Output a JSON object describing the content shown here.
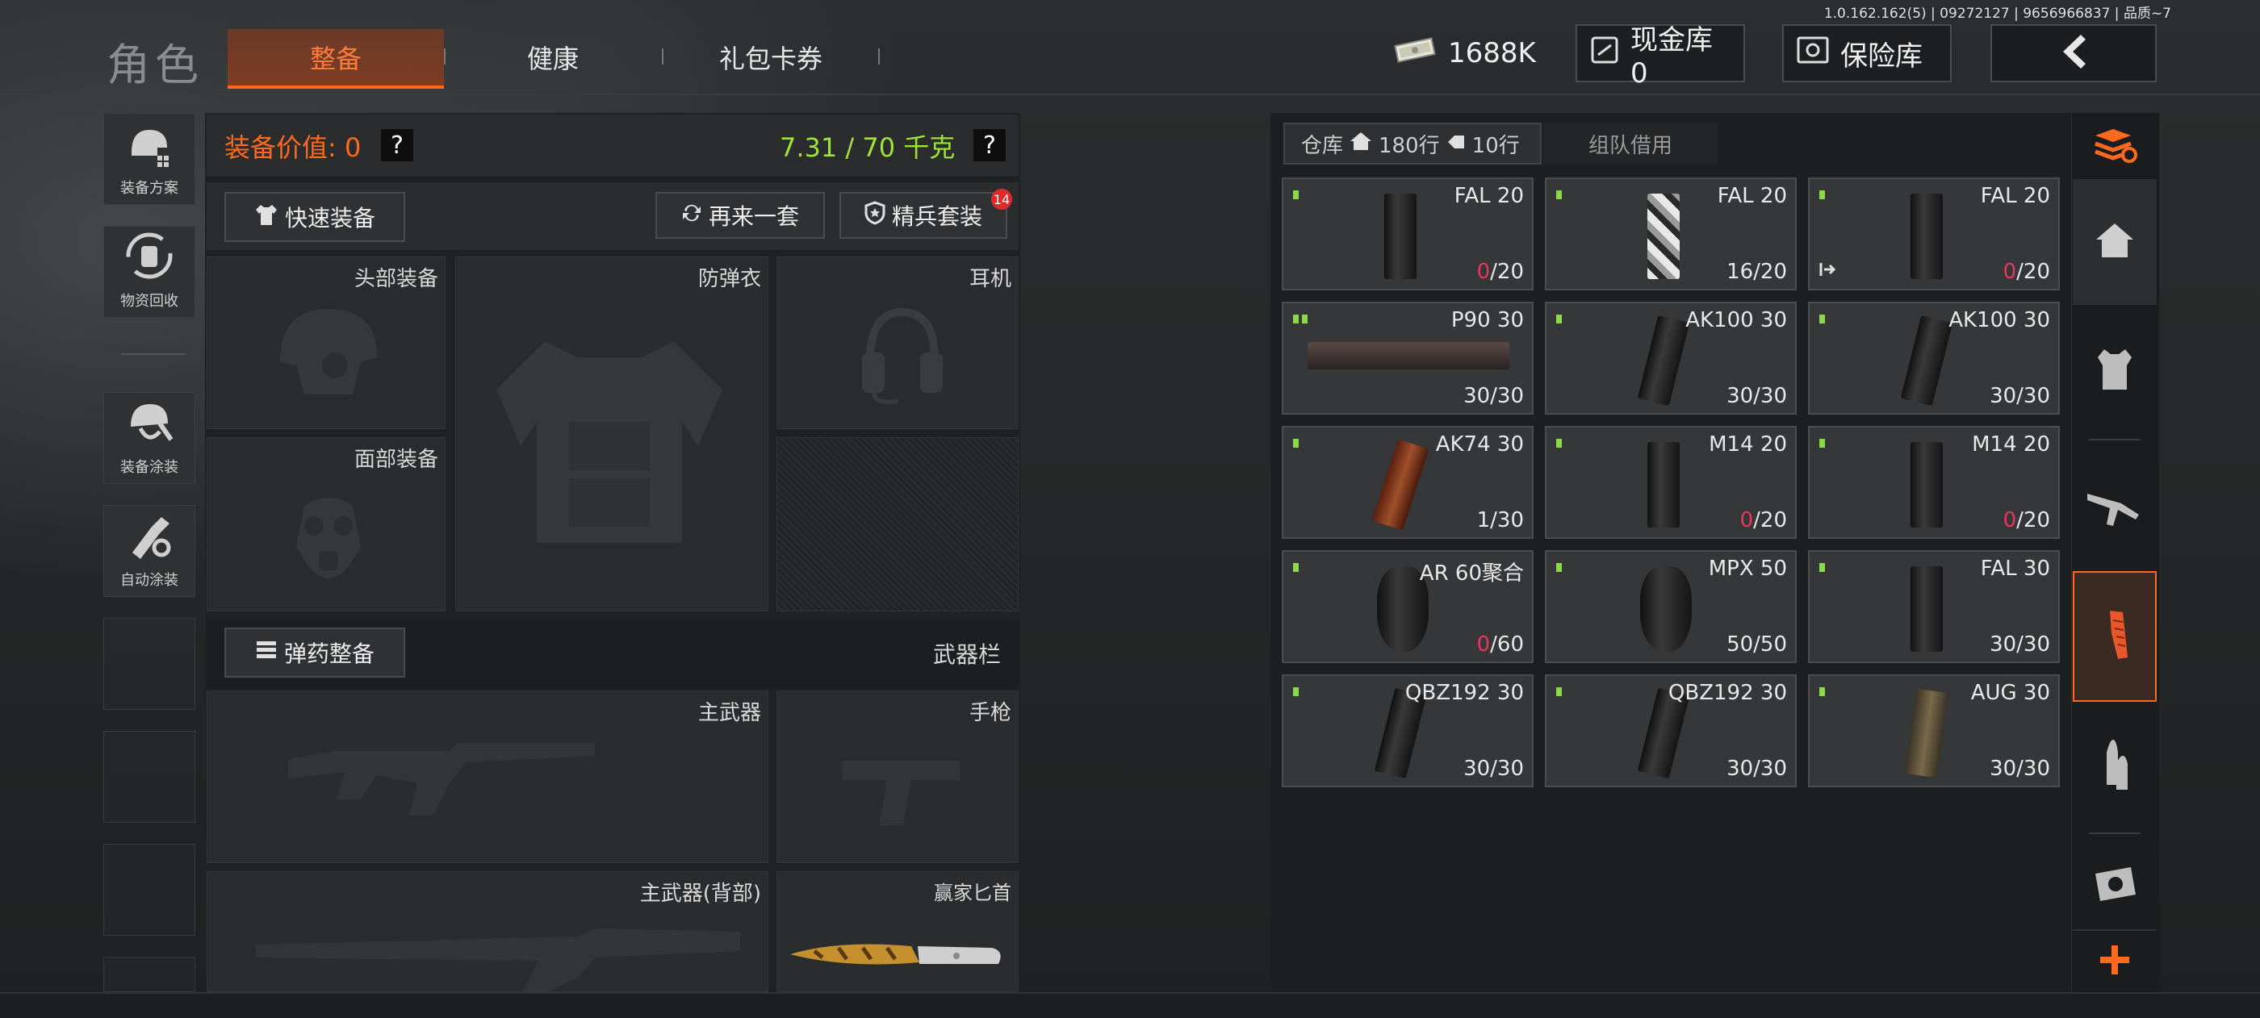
{
  "version": "1.0.162.162(5) | 09272127 | 9656966837 | 品质~7",
  "header": {
    "title": "角色",
    "tabs": [
      {
        "label": "整备",
        "active": true
      },
      {
        "label": "健康",
        "active": false
      },
      {
        "label": "礼包卡券",
        "active": false
      }
    ],
    "currency": "1688K",
    "cash_vault": "现金库 0",
    "safe": "保险库"
  },
  "left_rail": [
    {
      "label": "装备方案",
      "icon": "helmet-plan-icon"
    },
    {
      "label": "物资回收",
      "icon": "recycle-icon"
    },
    {
      "label": "装备涂装",
      "icon": "paint-helmet-icon"
    },
    {
      "label": "自动涂装",
      "icon": "auto-paint-icon"
    }
  ],
  "equipment": {
    "value_label": "装备价值: 0",
    "weight": "7.31 / 70 千克",
    "help": "?",
    "quick_equip": "快速装备",
    "again": "再来一套",
    "elite_set": "精兵套装",
    "elite_badge": "14",
    "slots": {
      "head": "头部装备",
      "armor": "防弹衣",
      "headset": "耳机",
      "face": "面部装备"
    },
    "ammo_prep": "弹药整备",
    "weapon_bar": "武器栏",
    "primary": "主武器",
    "pistol": "手枪",
    "primary_back": "主武器(背部)",
    "knife": "赢家匕首"
  },
  "warehouse": {
    "tab_label": "仓库",
    "rows_home": "180行",
    "rows_ticket": "10行",
    "team_borrow": "组队借用",
    "items": [
      {
        "name": "FAL 20",
        "cur": "0",
        "max": "/20",
        "zero": true,
        "dots": 1
      },
      {
        "name": "FAL 20",
        "cur": "16",
        "max": "/20",
        "zero": false,
        "dots": 1
      },
      {
        "name": "FAL 20",
        "cur": "0",
        "max": "/20",
        "zero": true,
        "dots": 1
      },
      {
        "name": "P90 30",
        "cur": "30",
        "max": "/30",
        "zero": false,
        "dots": 2
      },
      {
        "name": "AK100 30",
        "cur": "30",
        "max": "/30",
        "zero": false,
        "dots": 1
      },
      {
        "name": "AK100 30",
        "cur": "30",
        "max": "/30",
        "zero": false,
        "dots": 1
      },
      {
        "name": "AK74 30",
        "cur": "1",
        "max": "/30",
        "zero": false,
        "dots": 1
      },
      {
        "name": "M14 20",
        "cur": "0",
        "max": "/20",
        "zero": true,
        "dots": 1
      },
      {
        "name": "M14 20",
        "cur": "0",
        "max": "/20",
        "zero": true,
        "dots": 1
      },
      {
        "name": "AR 60聚合",
        "cur": "0",
        "max": "/60",
        "zero": true,
        "dots": 1
      },
      {
        "name": "MPX 50",
        "cur": "50",
        "max": "/50",
        "zero": false,
        "dots": 1
      },
      {
        "name": "FAL 30",
        "cur": "30",
        "max": "/30",
        "zero": false,
        "dots": 1
      },
      {
        "name": "QBZ192 30",
        "cur": "30",
        "max": "/30",
        "zero": false,
        "dots": 1
      },
      {
        "name": "QBZ192 30",
        "cur": "30",
        "max": "/30",
        "zero": false,
        "dots": 1
      },
      {
        "name": "AUG 30",
        "cur": "30",
        "max": "/30",
        "zero": false,
        "dots": 1
      }
    ]
  },
  "right_rail": [
    "sort-stack-icon",
    "home-icon",
    "vest-icon",
    "rifle-icon",
    "magazine-icon",
    "ammo-icon",
    "scope-icon",
    "plus-icon"
  ],
  "colors": {
    "accent": "#ff6a1f",
    "weight": "#9fe33a",
    "zero": "#e8365d",
    "value": "#ff6a1f"
  }
}
